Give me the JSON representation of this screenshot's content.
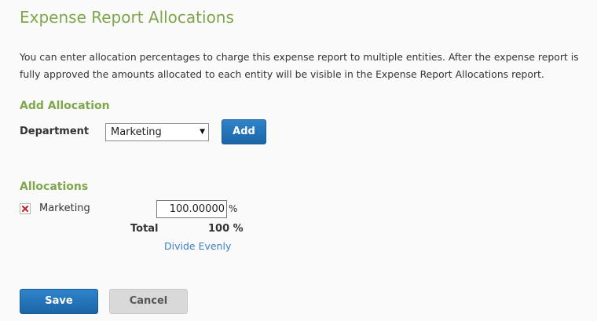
{
  "page": {
    "title": "Expense Report Allocations",
    "intro": "You can enter allocation percentages to charge this expense report to multiple entities. After the expense report is fully approved the amounts allocated to each entity will be visible in the Expense Report Allocations report."
  },
  "add_allocation": {
    "heading": "Add Allocation",
    "department_label": "Department",
    "department_selected": "Marketing",
    "dropdown_arrow": "▼",
    "add_label": "Add"
  },
  "allocations": {
    "heading": "Allocations",
    "rows": [
      {
        "name": "Marketing",
        "percentage": "100.00000",
        "percent_sign": "%",
        "remove_icon": "close-x-icon"
      }
    ],
    "total_label": "Total",
    "total_value": "100 %",
    "divide_evenly_label": "Divide Evenly"
  },
  "actions": {
    "save_label": "Save",
    "cancel_label": "Cancel"
  },
  "colors": {
    "heading_green": "#7fa64a",
    "primary_blue": "#1b65a8",
    "link_blue": "#3b7fc4",
    "remove_red": "#c0262d",
    "cancel_gray": "#d9d9d9"
  }
}
